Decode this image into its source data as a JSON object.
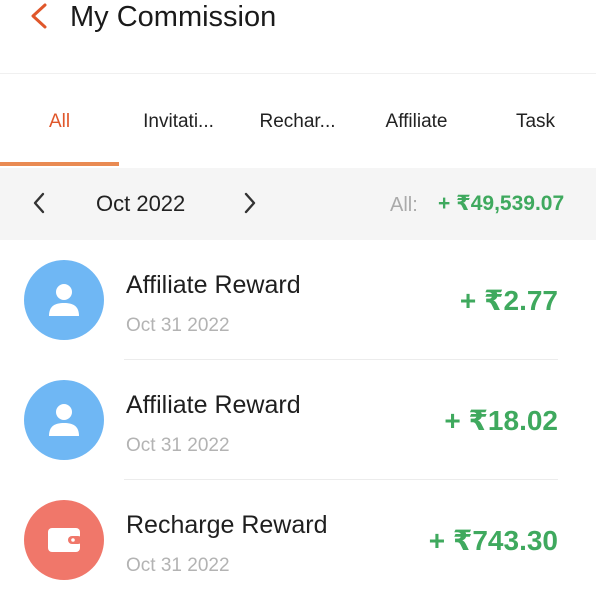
{
  "header": {
    "title": "My Commission"
  },
  "tabs": [
    {
      "label": "All",
      "active": true
    },
    {
      "label": "Invitati..."
    },
    {
      "label": "Rechar..."
    },
    {
      "label": "Affiliate"
    },
    {
      "label": "Task"
    }
  ],
  "month_bar": {
    "month": "Oct 2022",
    "total_label": "All:",
    "total_value": "+ ₹49,539.07"
  },
  "records": [
    {
      "title": "Affiliate Reward",
      "date": "Oct 31 2022",
      "amount": "+ ₹2.77",
      "icon": "user-icon"
    },
    {
      "title": "Affiliate Reward",
      "date": "Oct 31 2022",
      "amount": "+ ₹18.02",
      "icon": "user-icon"
    },
    {
      "title": "Recharge Reward",
      "date": "Oct 31 2022",
      "amount": "+ ₹743.30",
      "icon": "wallet-icon"
    }
  ],
  "colors": {
    "accent": "#e0572b",
    "positive": "#3fa95e",
    "affiliate_icon_bg": "#6fb7f4",
    "recharge_icon_bg": "#f0776a"
  }
}
